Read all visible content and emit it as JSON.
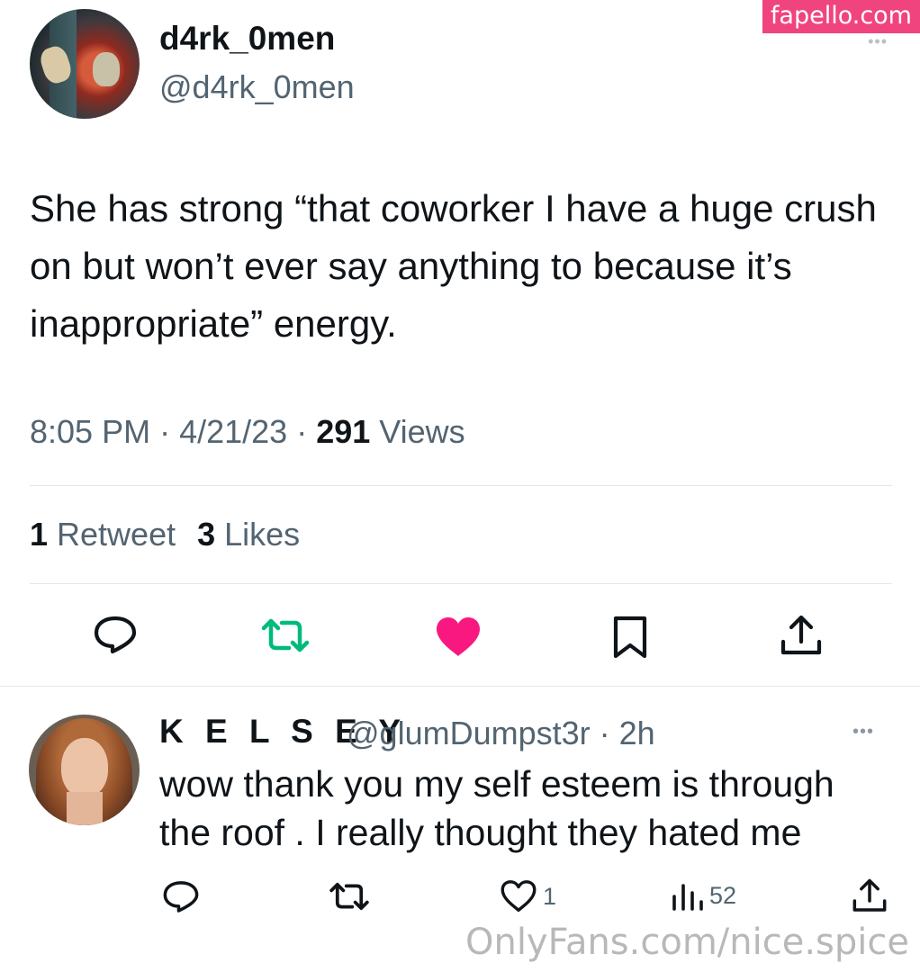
{
  "watermark": {
    "top": "fapello.com",
    "bottom": "OnlyFans.com/nice.spice"
  },
  "tweet": {
    "display_name": "d4rk_0men",
    "handle": "@d4rk_0men",
    "more_icon": "more-dots-icon",
    "text": "She has strong “that coworker I have a huge crush on but won’t ever say anything to because it’s inappropriate” energy.",
    "time": "8:05 PM",
    "sep1": " · ",
    "date": "4/21/23",
    "sep2": " · ",
    "views_count": "291",
    "views_label": " Views",
    "retweets_count": "1",
    "retweets_label": " Retweet",
    "likes_count": "3",
    "likes_label": " Likes",
    "actions": [
      {
        "name": "reply",
        "icon": "reply-icon"
      },
      {
        "name": "retweet",
        "icon": "retweet-icon",
        "color": "#00ba7c"
      },
      {
        "name": "like",
        "icon": "heart-filled-icon",
        "color": "#f91880"
      },
      {
        "name": "bookmark",
        "icon": "bookmark-icon"
      },
      {
        "name": "share",
        "icon": "share-icon"
      }
    ]
  },
  "reply": {
    "display_name": "K E L S E Y",
    "handle": "@glumDumpst3r",
    "sep": " · ",
    "age": "2h",
    "text": "wow thank you my self esteem is through the roof . I really thought they hated me",
    "likes": "1",
    "views": "52",
    "actions": [
      {
        "name": "reply",
        "icon": "reply-icon"
      },
      {
        "name": "retweet",
        "icon": "retweet-icon"
      },
      {
        "name": "like",
        "icon": "heart-outline-icon"
      },
      {
        "name": "views",
        "icon": "bar-chart-icon"
      },
      {
        "name": "share",
        "icon": "share-icon"
      }
    ]
  },
  "colors": {
    "text": "#0f1419",
    "secondary": "#536471",
    "retweet": "#00ba7c",
    "like": "#f91880",
    "divider": "#e1e8ed"
  }
}
